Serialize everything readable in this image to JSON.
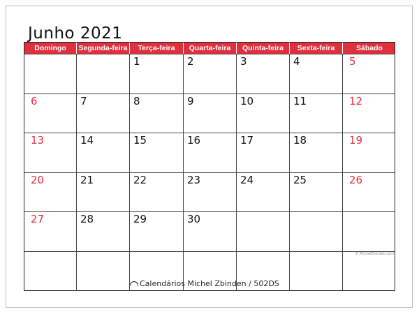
{
  "title": "Junho 2021",
  "weekdays": [
    "Domingo",
    "Segunda-feira",
    "Terça-feira",
    "Quarta-feira",
    "Quinta-feira",
    "Sexta-feira",
    "Sábado"
  ],
  "weeks": [
    [
      "",
      "",
      "1",
      "2",
      "3",
      "4",
      "5"
    ],
    [
      "6",
      "7",
      "8",
      "9",
      "10",
      "11",
      "12"
    ],
    [
      "13",
      "14",
      "15",
      "16",
      "17",
      "18",
      "19"
    ],
    [
      "20",
      "21",
      "22",
      "23",
      "24",
      "25",
      "26"
    ],
    [
      "27",
      "28",
      "29",
      "30",
      "",
      "",
      ""
    ],
    [
      "",
      "",
      "",
      "",
      "",
      "",
      ""
    ]
  ],
  "colors": {
    "accent": "#e0303e",
    "text": "#111111",
    "grid": "#444444"
  },
  "footer": {
    "brand": "Calendários Michel Zbinden / 502DS",
    "brand_icon": "hat-icon",
    "copyright": "© MichelZbinden.com"
  }
}
